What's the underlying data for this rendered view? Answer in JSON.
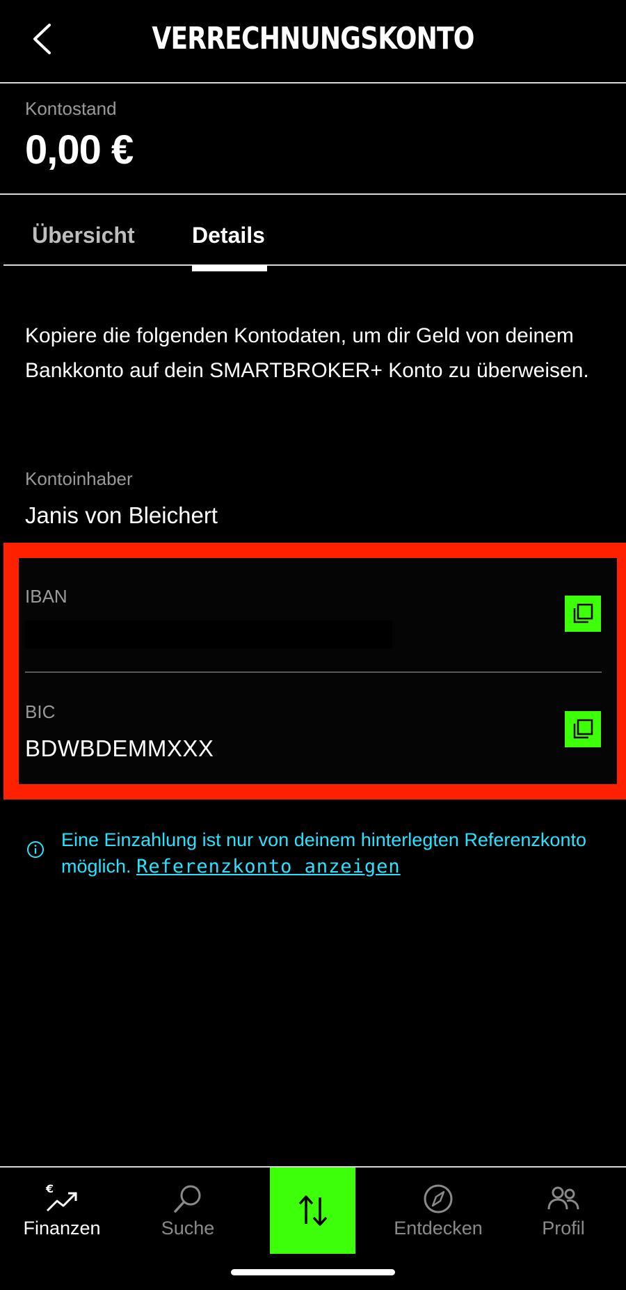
{
  "header": {
    "title": "VERRECHNUNGSKONTO",
    "back_icon": "chevron-left-icon"
  },
  "balance": {
    "label": "Kontostand",
    "value": "0,00 €"
  },
  "tabs": [
    {
      "label": "Übersicht",
      "active": false
    },
    {
      "label": "Details",
      "active": true
    }
  ],
  "description": "Kopiere die folgenden Kontodaten, um dir Geld von deinem Bankkonto auf dein SMARTBROKER+ Konto zu überweisen.",
  "account_holder": {
    "label": "Kontoinhaber",
    "value": "Janis von Bleichert"
  },
  "iban": {
    "label": "IBAN",
    "value": "",
    "copy_icon": "copy-icon"
  },
  "bic": {
    "label": "BIC",
    "value": "BDWBDEMMXXX",
    "copy_icon": "copy-icon"
  },
  "info": {
    "text": "Eine Einzahlung ist nur von deinem hinterlegten Referenzkonto möglich.",
    "link": "Referenzkonto anzeigen",
    "icon": "info-icon"
  },
  "nav": {
    "finanzen": "Finanzen",
    "suche": "Suche",
    "entdecken": "Entdecken",
    "profil": "Profil",
    "transfer_icon": "transfer-arrows-icon"
  },
  "colors": {
    "background": "#000000",
    "accent_green": "#3dff0a",
    "highlight_red": "#ff2000",
    "info_cyan": "#27e3ff",
    "muted_text": "#9a9a9a"
  }
}
